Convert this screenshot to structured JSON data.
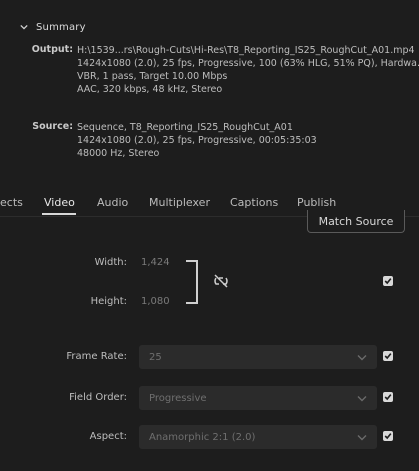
{
  "summary": {
    "title": "Summary",
    "output": {
      "label": "Output:",
      "lines": [
        "H:\\1539...rs\\Rough-Cuts\\Hi-Res\\T8_Reporting_IS25_RoughCut_A01.mp4",
        "1424x1080 (2.0), 25 fps, Progressive, 100 (63% HLG, 51% PQ), Hardwa...",
        "VBR, 1 pass, Target 10.00 Mbps",
        "AAC, 320 kbps, 48 kHz, Stereo"
      ]
    },
    "source": {
      "label": "Source:",
      "lines": [
        "Sequence, T8_Reporting_IS25_RoughCut_A01",
        "1424x1080 (2.0), 25 fps, Progressive, 00:05:35:03",
        "48000 Hz, Stereo"
      ]
    }
  },
  "tabs": [
    "ects",
    "Video",
    "Audio",
    "Multiplexer",
    "Captions",
    "Publish"
  ],
  "active_tab": "Video",
  "match_source_label": "Match Source",
  "width": {
    "label": "Width:",
    "value": "1,424"
  },
  "height": {
    "label": "Height:",
    "value": "1,080"
  },
  "frame_rate": {
    "label": "Frame Rate:",
    "value": "25"
  },
  "field_order": {
    "label": "Field Order:",
    "value": "Progressive"
  },
  "aspect": {
    "label": "Aspect:",
    "value": "Anamorphic 2:1 (2.0)"
  },
  "icons": {
    "summary_toggle": "chevron-down-icon",
    "link": "unlink-icon",
    "dropdown": "chevron-down-icon",
    "checkbox": "checkmark-icon"
  },
  "colors": {
    "background": "#1d1d1d",
    "field": "#2b2b2b",
    "text": "#c8c8c8"
  }
}
